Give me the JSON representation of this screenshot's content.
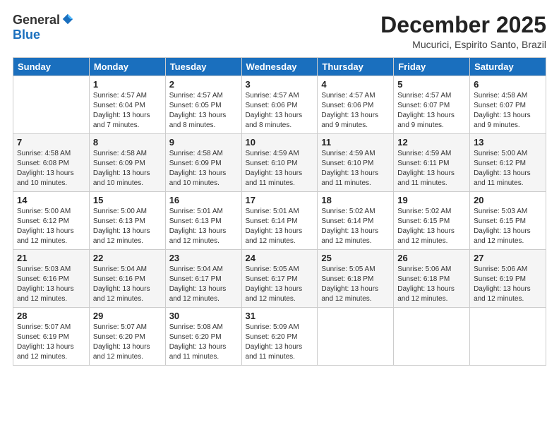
{
  "logo": {
    "general": "General",
    "blue": "Blue"
  },
  "header": {
    "month": "December 2025",
    "location": "Mucurici, Espirito Santo, Brazil"
  },
  "days": [
    "Sunday",
    "Monday",
    "Tuesday",
    "Wednesday",
    "Thursday",
    "Friday",
    "Saturday"
  ],
  "weeks": [
    [
      {
        "day": "",
        "content": ""
      },
      {
        "day": "1",
        "content": "Sunrise: 4:57 AM\nSunset: 6:04 PM\nDaylight: 13 hours\nand 7 minutes."
      },
      {
        "day": "2",
        "content": "Sunrise: 4:57 AM\nSunset: 6:05 PM\nDaylight: 13 hours\nand 8 minutes."
      },
      {
        "day": "3",
        "content": "Sunrise: 4:57 AM\nSunset: 6:06 PM\nDaylight: 13 hours\nand 8 minutes."
      },
      {
        "day": "4",
        "content": "Sunrise: 4:57 AM\nSunset: 6:06 PM\nDaylight: 13 hours\nand 9 minutes."
      },
      {
        "day": "5",
        "content": "Sunrise: 4:57 AM\nSunset: 6:07 PM\nDaylight: 13 hours\nand 9 minutes."
      },
      {
        "day": "6",
        "content": "Sunrise: 4:58 AM\nSunset: 6:07 PM\nDaylight: 13 hours\nand 9 minutes."
      }
    ],
    [
      {
        "day": "7",
        "content": "Sunrise: 4:58 AM\nSunset: 6:08 PM\nDaylight: 13 hours\nand 10 minutes."
      },
      {
        "day": "8",
        "content": "Sunrise: 4:58 AM\nSunset: 6:09 PM\nDaylight: 13 hours\nand 10 minutes."
      },
      {
        "day": "9",
        "content": "Sunrise: 4:58 AM\nSunset: 6:09 PM\nDaylight: 13 hours\nand 10 minutes."
      },
      {
        "day": "10",
        "content": "Sunrise: 4:59 AM\nSunset: 6:10 PM\nDaylight: 13 hours\nand 11 minutes."
      },
      {
        "day": "11",
        "content": "Sunrise: 4:59 AM\nSunset: 6:10 PM\nDaylight: 13 hours\nand 11 minutes."
      },
      {
        "day": "12",
        "content": "Sunrise: 4:59 AM\nSunset: 6:11 PM\nDaylight: 13 hours\nand 11 minutes."
      },
      {
        "day": "13",
        "content": "Sunrise: 5:00 AM\nSunset: 6:12 PM\nDaylight: 13 hours\nand 11 minutes."
      }
    ],
    [
      {
        "day": "14",
        "content": "Sunrise: 5:00 AM\nSunset: 6:12 PM\nDaylight: 13 hours\nand 12 minutes."
      },
      {
        "day": "15",
        "content": "Sunrise: 5:00 AM\nSunset: 6:13 PM\nDaylight: 13 hours\nand 12 minutes."
      },
      {
        "day": "16",
        "content": "Sunrise: 5:01 AM\nSunset: 6:13 PM\nDaylight: 13 hours\nand 12 minutes."
      },
      {
        "day": "17",
        "content": "Sunrise: 5:01 AM\nSunset: 6:14 PM\nDaylight: 13 hours\nand 12 minutes."
      },
      {
        "day": "18",
        "content": "Sunrise: 5:02 AM\nSunset: 6:14 PM\nDaylight: 13 hours\nand 12 minutes."
      },
      {
        "day": "19",
        "content": "Sunrise: 5:02 AM\nSunset: 6:15 PM\nDaylight: 13 hours\nand 12 minutes."
      },
      {
        "day": "20",
        "content": "Sunrise: 5:03 AM\nSunset: 6:15 PM\nDaylight: 13 hours\nand 12 minutes."
      }
    ],
    [
      {
        "day": "21",
        "content": "Sunrise: 5:03 AM\nSunset: 6:16 PM\nDaylight: 13 hours\nand 12 minutes."
      },
      {
        "day": "22",
        "content": "Sunrise: 5:04 AM\nSunset: 6:16 PM\nDaylight: 13 hours\nand 12 minutes."
      },
      {
        "day": "23",
        "content": "Sunrise: 5:04 AM\nSunset: 6:17 PM\nDaylight: 13 hours\nand 12 minutes."
      },
      {
        "day": "24",
        "content": "Sunrise: 5:05 AM\nSunset: 6:17 PM\nDaylight: 13 hours\nand 12 minutes."
      },
      {
        "day": "25",
        "content": "Sunrise: 5:05 AM\nSunset: 6:18 PM\nDaylight: 13 hours\nand 12 minutes."
      },
      {
        "day": "26",
        "content": "Sunrise: 5:06 AM\nSunset: 6:18 PM\nDaylight: 13 hours\nand 12 minutes."
      },
      {
        "day": "27",
        "content": "Sunrise: 5:06 AM\nSunset: 6:19 PM\nDaylight: 13 hours\nand 12 minutes."
      }
    ],
    [
      {
        "day": "28",
        "content": "Sunrise: 5:07 AM\nSunset: 6:19 PM\nDaylight: 13 hours\nand 12 minutes."
      },
      {
        "day": "29",
        "content": "Sunrise: 5:07 AM\nSunset: 6:20 PM\nDaylight: 13 hours\nand 12 minutes."
      },
      {
        "day": "30",
        "content": "Sunrise: 5:08 AM\nSunset: 6:20 PM\nDaylight: 13 hours\nand 11 minutes."
      },
      {
        "day": "31",
        "content": "Sunrise: 5:09 AM\nSunset: 6:20 PM\nDaylight: 13 hours\nand 11 minutes."
      },
      {
        "day": "",
        "content": ""
      },
      {
        "day": "",
        "content": ""
      },
      {
        "day": "",
        "content": ""
      }
    ]
  ]
}
